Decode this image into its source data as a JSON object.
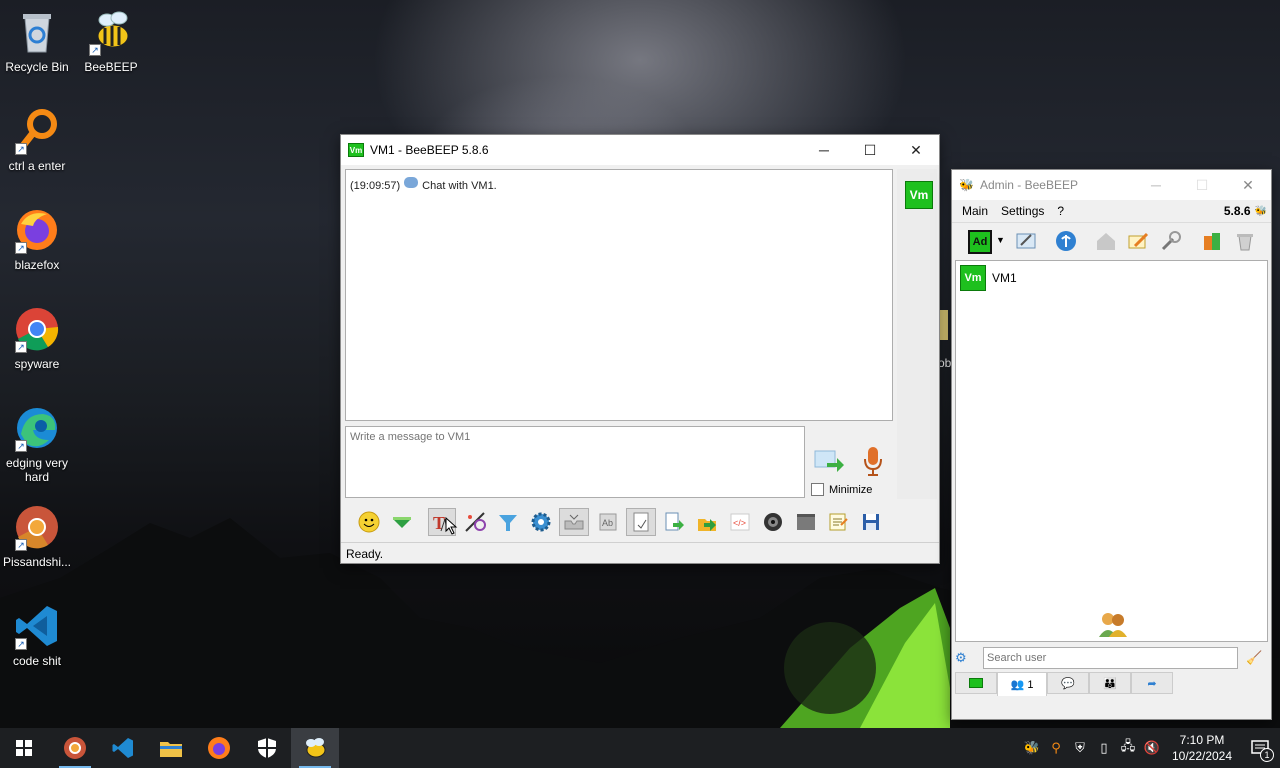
{
  "desktop": {
    "icons": [
      {
        "label": "Recycle Bin",
        "icon": "recycle-bin-icon"
      },
      {
        "label": "BeeBEEP",
        "icon": "beebeep-icon"
      },
      {
        "label": "ctrl a enter",
        "icon": "search-orange-icon"
      },
      {
        "label": "blazefox",
        "icon": "firefox-icon"
      },
      {
        "label": "spyware",
        "icon": "chrome-icon"
      },
      {
        "label": "edging very hard",
        "icon": "edge-icon"
      },
      {
        "label": "Pissandshi...",
        "icon": "chrome-canary-icon"
      },
      {
        "label": "code shit",
        "icon": "vscode-icon"
      }
    ],
    "partial_label": "ob"
  },
  "chat_window": {
    "title": "VM1 - BeeBEEP 5.8.6",
    "title_badge": "Vm",
    "history": {
      "time": "(19:09:57)",
      "text": "Chat with VM1."
    },
    "input_placeholder": "Write a message to VM1",
    "side_badge": "Vm",
    "minimize_label": "Minimize",
    "status": "Ready.",
    "toolbar": [
      "emoticon-icon",
      "font-color-icon",
      "text-format-icon",
      "palette-icon",
      "filter-icon",
      "settings-gear-icon",
      "inbox-icon",
      "spell-icon",
      "page-icon",
      "file-send-icon",
      "folder-share-icon",
      "code-icon",
      "camera-icon",
      "clear-icon",
      "notes-icon",
      "save-icon"
    ]
  },
  "admin_window": {
    "title": "Admin - BeeBEEP",
    "menu": [
      "Main",
      "Settings",
      "?"
    ],
    "version": "5.8.6",
    "avatar_badge": "Ad",
    "users": [
      {
        "badge": "Vm",
        "name": "VM1"
      }
    ],
    "search_placeholder": "Search user",
    "tabs": [
      {
        "label": ""
      },
      {
        "label": "1"
      },
      {
        "label": ""
      },
      {
        "label": ""
      },
      {
        "label": ""
      }
    ]
  },
  "taskbar": {
    "time": "7:10 PM",
    "date": "10/22/2024",
    "notification_count": "1"
  },
  "colors": {
    "vm_green": "#1ec01e",
    "desktop_dark": "#1b1e25",
    "taskbar": "#1d1f22"
  }
}
